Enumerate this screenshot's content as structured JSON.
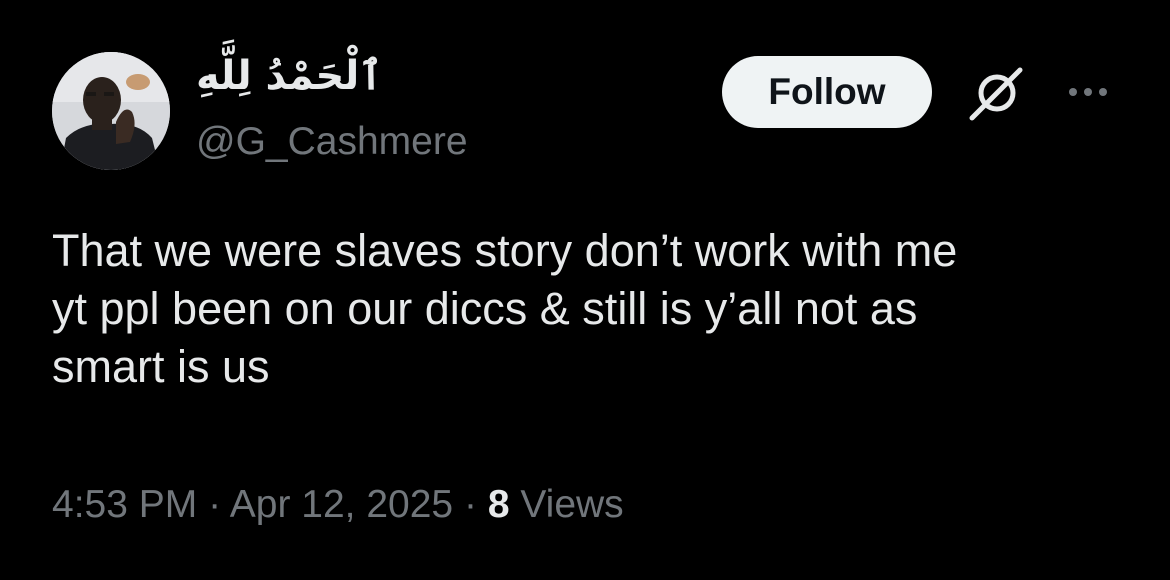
{
  "author": {
    "display_name": "ٱلْحَمْدُ لِلَّهِ",
    "handle": "@G_Cashmere",
    "avatar_icon": "profile-photo"
  },
  "actions": {
    "follow_label": "Follow",
    "grok_icon": "grok-icon",
    "more_icon": "more-options-icon"
  },
  "tweet": {
    "lines": [
      "That we were slaves story don’t work with me",
      "yt ppl been on our diccs & still is y’all not as",
      "smart is us"
    ]
  },
  "meta": {
    "time": "4:53 PM",
    "separator": "·",
    "date": "Apr 12, 2025",
    "views_count": "8",
    "views_label": "Views"
  },
  "colors": {
    "background": "#000000",
    "text_primary": "#e7e9ea",
    "text_secondary": "#71767b",
    "follow_bg": "#eff3f4",
    "follow_text": "#0f1419"
  }
}
